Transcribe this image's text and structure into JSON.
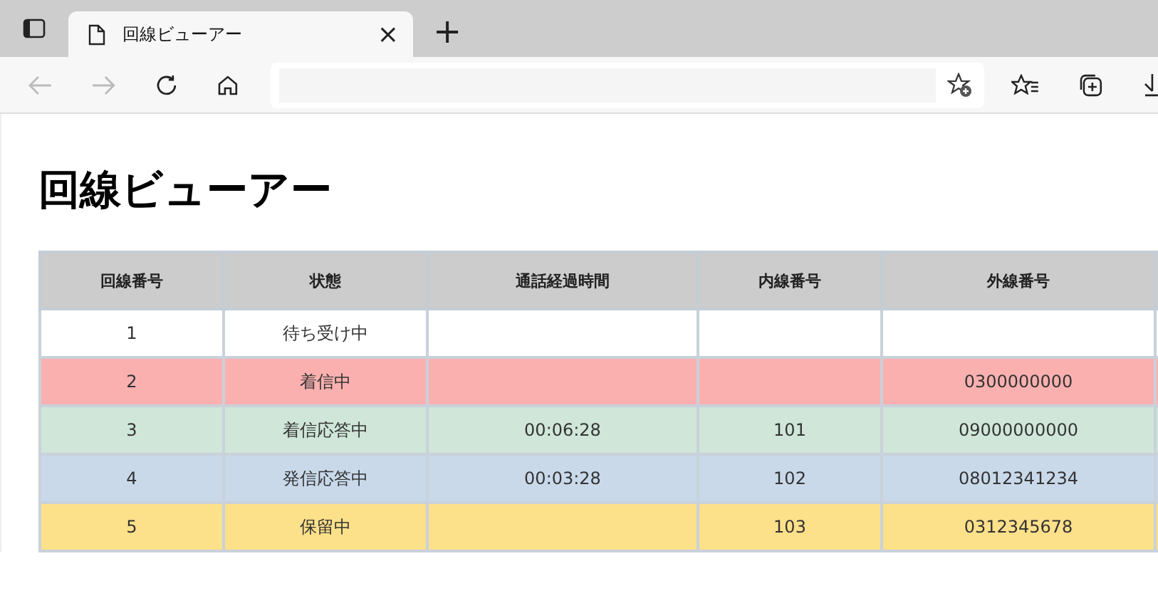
{
  "browser": {
    "tab": {
      "title": "回線ビューアー",
      "close": "×"
    },
    "new_tab": "+"
  },
  "page": {
    "title": "回線ビューアー"
  },
  "table": {
    "columns": [
      "回線番号",
      "状態",
      "通話経過時間",
      "内線番号",
      "外線番号"
    ],
    "rows": [
      {
        "color": "#ffffff",
        "cells": [
          "1",
          "待ち受け中",
          "",
          "",
          ""
        ]
      },
      {
        "color": "#fbb0b0",
        "cells": [
          "2",
          "着信中",
          "",
          "",
          "0300000000"
        ]
      },
      {
        "color": "#cfe6d9",
        "cells": [
          "3",
          "着信応答中",
          "00:06:28",
          "101",
          "09000000000"
        ]
      },
      {
        "color": "#c9d9ea",
        "cells": [
          "4",
          "発信応答中",
          "00:03:28",
          "102",
          "08012341234"
        ]
      },
      {
        "color": "#fde08a",
        "cells": [
          "5",
          "保留中",
          "",
          "103",
          "0312345678"
        ]
      }
    ]
  }
}
